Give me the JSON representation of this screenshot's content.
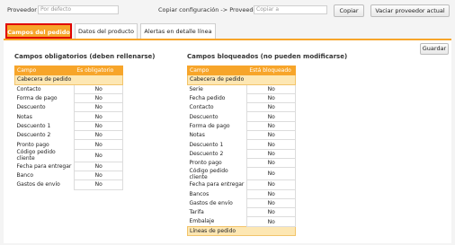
{
  "topbar": {
    "proveedor_label": "Proveedor",
    "proveedor_placeholder": "Por defecto",
    "copiar_label": "Copiar configuración -> Proveedor:",
    "copiar_placeholder": "Copiar a",
    "copiar_button": "Copiar",
    "vaciar_button": "Vaciar proveedor actual"
  },
  "tabs": [
    "Campos del pedido",
    "Datos del producto",
    "Alertas en detalle línea"
  ],
  "guardar_button": "Guardar",
  "left": {
    "title": "Campos obligatorios (deben rellenarse)",
    "col_campo": "Campo",
    "col_valor": "Es obligatorio",
    "header_row": "Cabecera de pedido",
    "rows": [
      {
        "campo": "Contacto",
        "valor": "No"
      },
      {
        "campo": "Forma de pago",
        "valor": "No"
      },
      {
        "campo": "Descuento",
        "valor": "No"
      },
      {
        "campo": "Notas",
        "valor": "No"
      },
      {
        "campo": "Descuento 1",
        "valor": "No"
      },
      {
        "campo": "Descuento 2",
        "valor": "No"
      },
      {
        "campo": "Pronto pago",
        "valor": "No"
      },
      {
        "campo": "Código pedido cliente",
        "valor": "No"
      },
      {
        "campo": "Fecha para entregar",
        "valor": "No"
      },
      {
        "campo": "Banco",
        "valor": "No"
      },
      {
        "campo": "Gastos de envío",
        "valor": "No"
      }
    ]
  },
  "right": {
    "title": "Campos bloqueados (no pueden modificarse)",
    "col_campo": "Campo",
    "col_valor": "Está bloqueado",
    "header_row": "Cabecera de pedido",
    "rows": [
      {
        "campo": "Serie",
        "valor": "No"
      },
      {
        "campo": "Fecha pedido",
        "valor": "No"
      },
      {
        "campo": "Contacto",
        "valor": "No"
      },
      {
        "campo": "Descuento",
        "valor": "No"
      },
      {
        "campo": "Forma de pago",
        "valor": "No"
      },
      {
        "campo": "Notas",
        "valor": "No"
      },
      {
        "campo": "Descuento 1",
        "valor": "No"
      },
      {
        "campo": "Descuento 2",
        "valor": "No"
      },
      {
        "campo": "Pronto pago",
        "valor": "No"
      },
      {
        "campo": "Código pedido cliente",
        "valor": "No"
      },
      {
        "campo": "Fecha para entregar",
        "valor": "No"
      },
      {
        "campo": "Bancos",
        "valor": "No"
      },
      {
        "campo": "Gastos de envío",
        "valor": "No"
      },
      {
        "campo": "Tarifa",
        "valor": "No"
      },
      {
        "campo": "Embalaje",
        "valor": "No"
      }
    ],
    "footer_row": "Líneas de pedido"
  },
  "colors": {
    "accent": "#f7a52a",
    "highlight_row": "#fde7b3",
    "active_tab_border": "#e00000"
  }
}
